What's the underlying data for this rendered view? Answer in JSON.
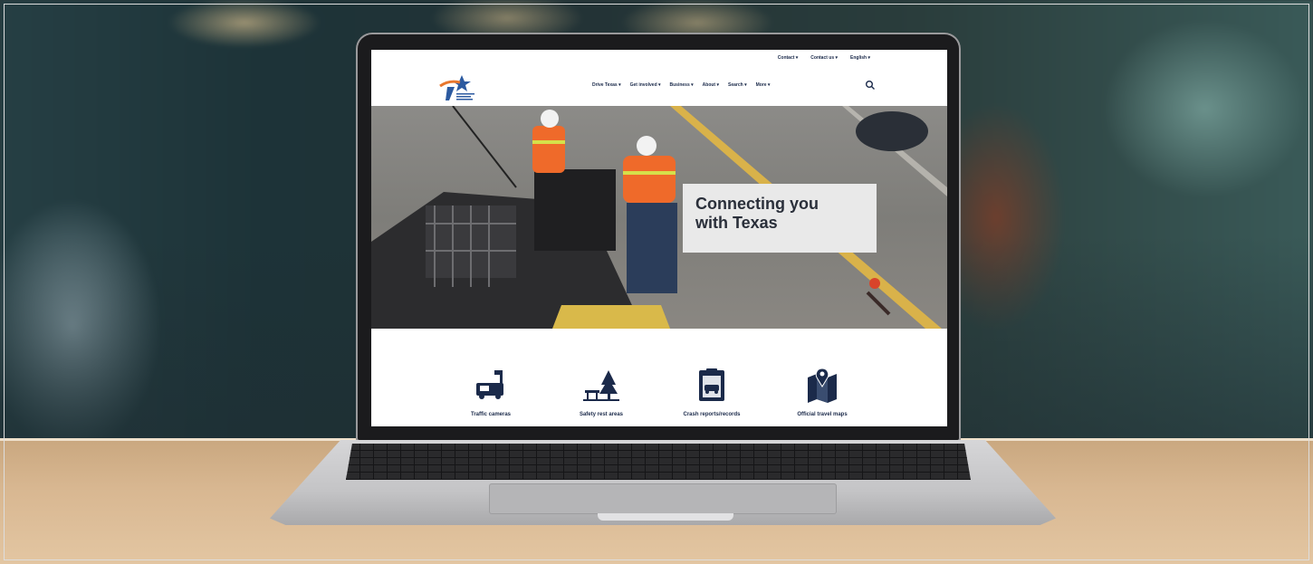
{
  "site": {
    "utility_links": [
      "Contact ▾",
      "Contact us ▾",
      "English ▾"
    ],
    "nav": [
      "Drive Texas ▾",
      "Get involved ▾",
      "Business ▾",
      "About ▾",
      "Search ▾",
      "More ▾"
    ],
    "hero": {
      "line1": "Connecting you",
      "line2": "with Texas"
    },
    "tiles": [
      {
        "label": "Traffic cameras",
        "icon": "traffic-camera-icon"
      },
      {
        "label": "Safety rest areas",
        "icon": "rest-area-icon"
      },
      {
        "label": "Crash reports/records",
        "icon": "crash-report-icon"
      },
      {
        "label": "Official travel maps",
        "icon": "travel-map-icon"
      }
    ]
  },
  "colors": {
    "navy": "#1b2a4a",
    "brand_orange": "#e8772e",
    "brand_blue": "#2c5aa0",
    "hero_card": "#e9e9e9"
  }
}
